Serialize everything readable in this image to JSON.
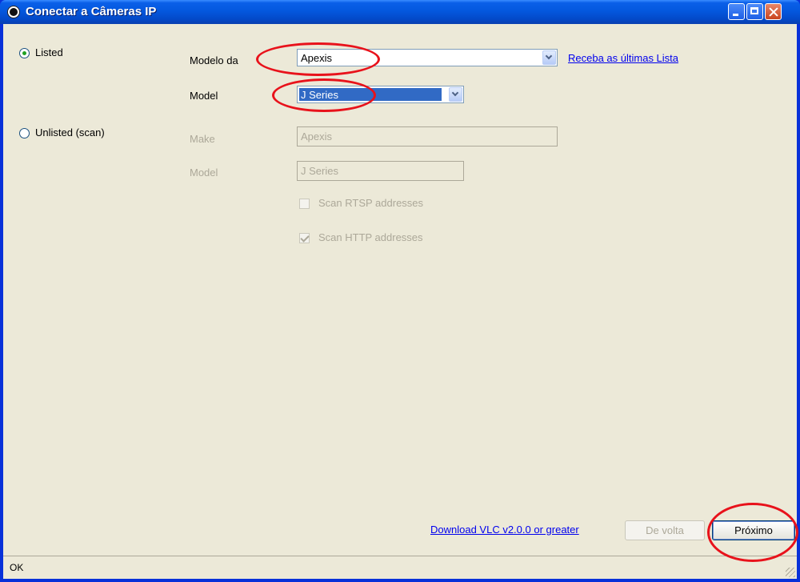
{
  "window": {
    "title": "Conectar a Câmeras IP"
  },
  "options": {
    "listed_label": "Listed",
    "unlisted_label": "Unlisted (scan)",
    "listed_selected": true
  },
  "listed": {
    "make_label": "Modelo da",
    "make_value": "Apexis",
    "model_label": "Model",
    "model_value": "J Series",
    "update_link": "Receba as últimas Lista"
  },
  "unlisted": {
    "make_label": "Make",
    "make_value": "Apexis",
    "model_label": "Model",
    "model_value": "J Series",
    "scan_rtsp_label": "Scan RTSP addresses",
    "scan_rtsp_checked": false,
    "scan_http_label": "Scan HTTP addresses",
    "scan_http_checked": true
  },
  "footer": {
    "vlc_link": "Download VLC v2.0.0 or greater",
    "back_label": "De volta",
    "next_label": "Próximo"
  },
  "status": {
    "text": "OK"
  },
  "annotation_color": "#e8121b"
}
